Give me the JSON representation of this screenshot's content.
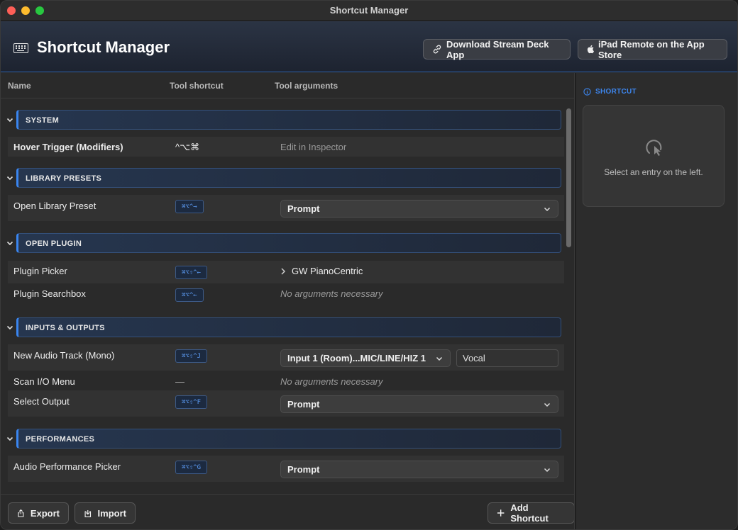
{
  "window": {
    "title": "Shortcut Manager"
  },
  "header": {
    "title": "Shortcut Manager",
    "download_button": "Download Stream Deck App",
    "ipad_button": "iPad Remote on the App Store"
  },
  "columns": {
    "name": "Name",
    "tool_shortcut": "Tool shortcut",
    "tool_arguments": "Tool arguments"
  },
  "sections": {
    "system": "SYSTEM",
    "library_presets": "LIBRARY PRESETS",
    "open_plugin": "OPEN PLUGIN",
    "inputs_outputs": "INPUTS & OUTPUTS",
    "performances": "PERFORMANCES"
  },
  "rows": {
    "hover": {
      "name": "Hover Trigger (Modifiers)",
      "shortcut": "^⌥⌘",
      "argument": "Edit in Inspector"
    },
    "library_preset": {
      "name": "Open Library Preset",
      "shortcut": "⌘⌥^→",
      "argument": "Prompt"
    },
    "plugin_picker": {
      "name": "Plugin Picker",
      "shortcut": "⌘⌥⇧^←",
      "argument": "GW PianoCentric"
    },
    "plugin_searchbox": {
      "name": "Plugin Searchbox",
      "shortcut": "⌘⌥^←",
      "argument": "No arguments necessary"
    },
    "new_audio_track": {
      "name": "New Audio Track (Mono)",
      "shortcut": "⌘⌥⇧^J",
      "argument": "Input 1 (Room)...MIC/LINE/HIZ 1",
      "text_value": "Vocal"
    },
    "scan_io": {
      "name": "Scan I/O Menu",
      "shortcut": "—",
      "argument": "No arguments necessary"
    },
    "select_output": {
      "name": "Select Output",
      "shortcut": "⌘⌥⇧^F",
      "argument": "Prompt"
    },
    "audio_perf": {
      "name": "Audio Performance Picker",
      "shortcut": "⌘⌥⇧^G",
      "argument": "Prompt"
    }
  },
  "footer": {
    "export": "Export",
    "import": "Import",
    "add": "Add Shortcut"
  },
  "inspector": {
    "heading": "SHORTCUT",
    "empty_message": "Select an entry on the left."
  },
  "icons": {
    "keyboard": "keyboard-icon",
    "link": "link-icon",
    "apple": "apple-icon",
    "chevron": "chevron-down-icon",
    "info": "info-icon",
    "cursor": "cursor-hover-icon",
    "export": "share-icon",
    "import": "import-icon",
    "plus": "plus-icon"
  },
  "colors": {
    "accent": "#3a86f0",
    "chip_text": "#5d9cf5",
    "section_bg": "#26364f"
  }
}
